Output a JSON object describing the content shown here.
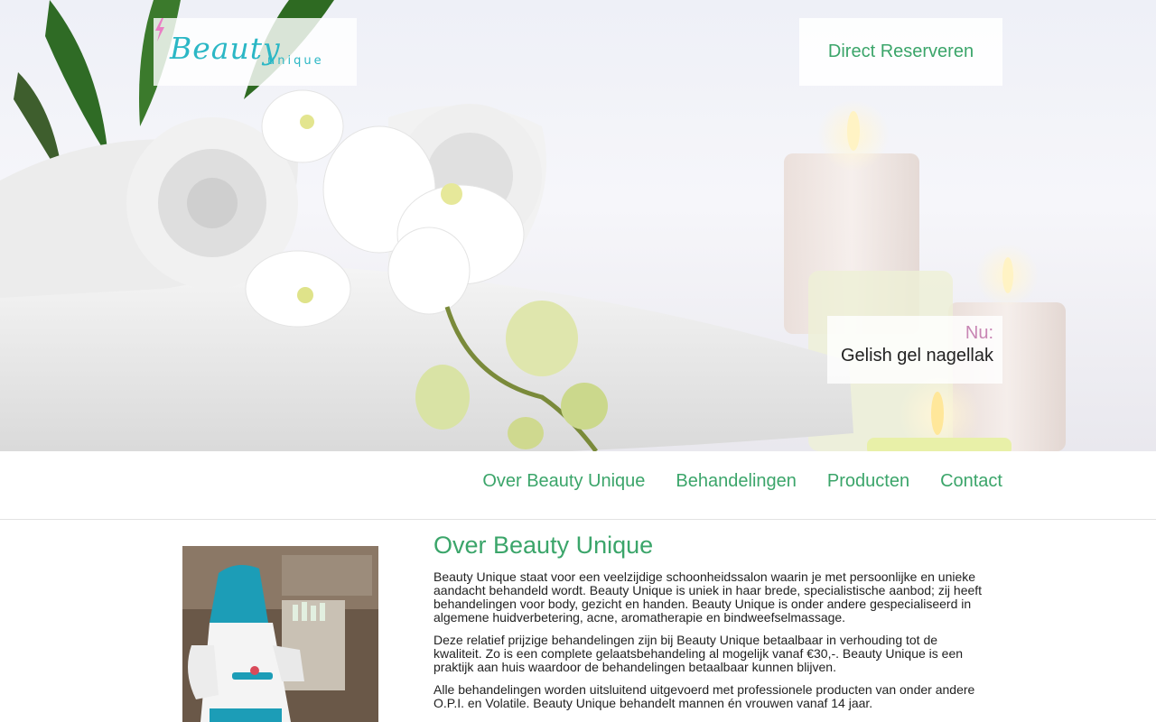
{
  "header": {
    "logo": {
      "script_text": "Beauty",
      "sub_text": "unique"
    },
    "reserve_button": "Direct Reserveren",
    "promo": {
      "label": "Nu:",
      "text": "Gelish gel nagellak"
    }
  },
  "nav": {
    "items": [
      "Over Beauty Unique",
      "Behandelingen",
      "Producten",
      "Contact"
    ]
  },
  "main": {
    "title": "Over Beauty Unique",
    "paragraphs": [
      "Beauty Unique staat voor een veelzijdige schoonheidssalon waarin je met persoonlijke en unieke aandacht behandeld wordt. Beauty Unique is uniek in haar brede, specialistische aanbod; zij heeft behandelingen voor body, gezicht en handen. Beauty Unique is onder andere gespecialiseerd in algemene huidverbetering, acne, aromatherapie en bindweefselmassage.",
      "Deze relatief prijzige behandelingen zijn bij Beauty Unique betaalbaar in verhouding tot de kwaliteit. Zo is een complete gelaatsbehandeling al mogelijk vanaf €30,-. Beauty Unique is een praktijk aan huis waardoor de behandelingen betaalbaar kunnen blijven.",
      "Alle behandelingen worden uitsluitend uitgevoerd met professionele producten van onder andere O.P.I. en Volatile. Beauty Unique behandelt mannen én vrouwen vanaf 14 jaar."
    ]
  },
  "colors": {
    "accent_green": "#3ba56a",
    "logo_teal": "#2bb7c5",
    "promo_pink": "#c886b4"
  }
}
